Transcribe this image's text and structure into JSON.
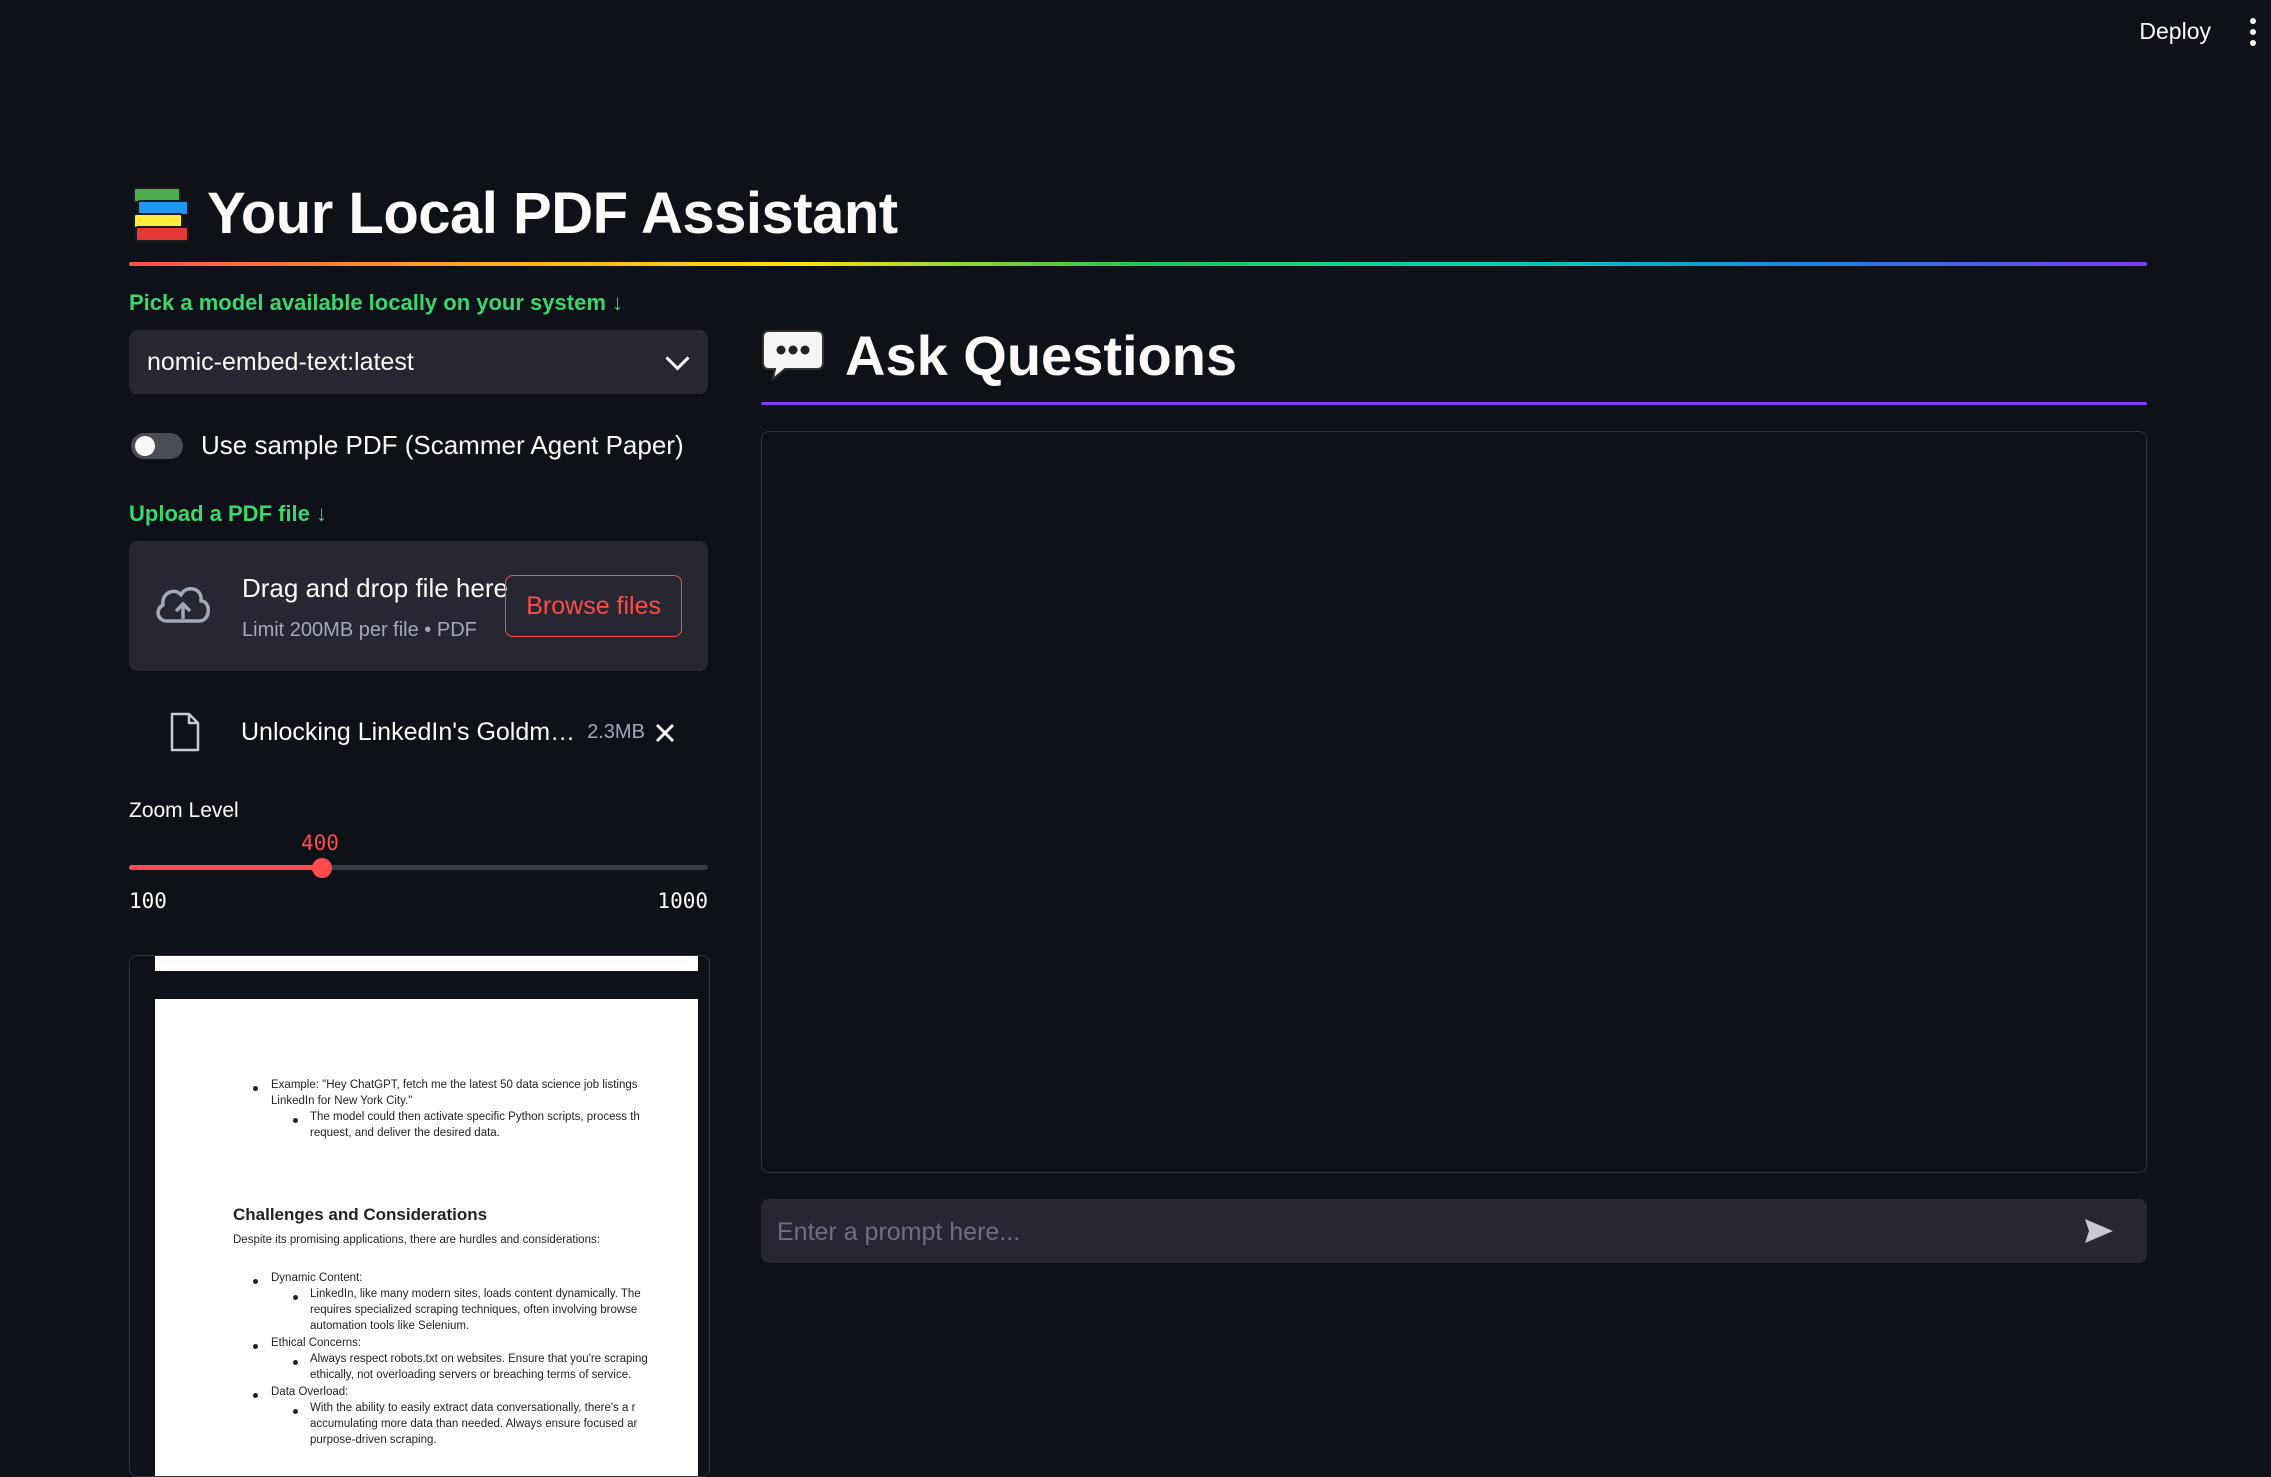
{
  "header": {
    "deploy_label": "Deploy",
    "menu_icon": "kebab-menu-icon"
  },
  "title": {
    "emoji_icon": "books-icon",
    "text": "Your Local PDF Assistant"
  },
  "sidebar": {
    "model_label": "Pick a model available locally on your system ↓",
    "model_selected": "nomic-embed-text:latest",
    "toggle_label": "Use sample PDF (Scammer Agent Paper)",
    "toggle_on": false,
    "upload_label": "Upload a PDF file ↓",
    "dropzone": {
      "title": "Drag and drop file here",
      "subtitle": "Limit 200MB per file • PDF",
      "browse_label": "Browse files"
    },
    "file": {
      "name": "Unlocking LinkedIn's Goldm…",
      "size": "2.3MB"
    },
    "zoom": {
      "label": "Zoom Level",
      "value": "400",
      "min": "100",
      "max": "1000"
    }
  },
  "pdf_preview": {
    "lines_top": [
      "Example: \"Hey ChatGPT, fetch me the latest 50 data science job listings",
      "LinkedIn for New York City.\"",
      "The model could then activate specific Python scripts, process th",
      "request, and deliver the desired data."
    ],
    "heading": "Challenges and Considerations",
    "intro": "Despite its promising applications, there are hurdles and considerations:",
    "items": [
      {
        "title": "Dynamic Content:",
        "sub": [
          "LinkedIn, like many modern sites, loads content dynamically. The",
          "requires specialized scraping techniques, often involving browse",
          "automation tools like Selenium."
        ]
      },
      {
        "title": "Ethical Concerns:",
        "sub": [
          "Always respect robots.txt on websites. Ensure that you're scraping",
          "ethically, not overloading servers or breaching terms of service."
        ]
      },
      {
        "title": "Data Overload:",
        "sub": [
          "With the ability to easily extract data conversationally, there's a r",
          "accumulating more data than needed. Always ensure focused ar",
          "purpose-driven scraping."
        ]
      }
    ]
  },
  "chat": {
    "heading": "Ask Questions",
    "heading_icon": "speech-balloon-icon",
    "prompt_placeholder": "Enter a prompt here...",
    "send_icon": "send-icon"
  },
  "colors": {
    "accent": "#ff4b4b",
    "green": "#3dd56d",
    "purple": "#803df5",
    "bg": "#0e1117",
    "panel": "#262730"
  }
}
